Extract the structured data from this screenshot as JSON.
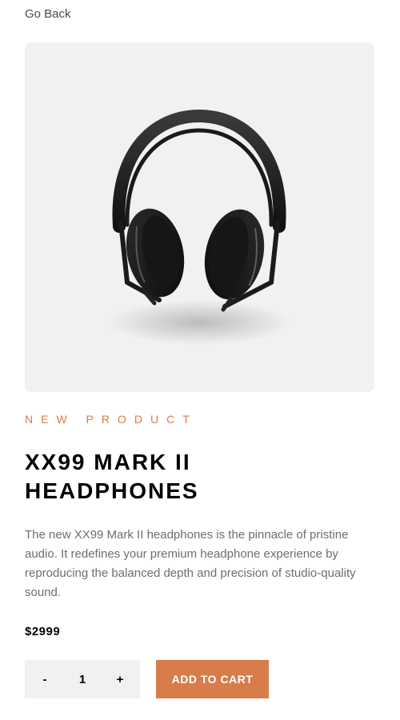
{
  "nav": {
    "back_label": "Go Back"
  },
  "product": {
    "overline": "NEW PRODUCT",
    "title_line1": "XX99 MARK II",
    "title_line2": "HEADPHONES",
    "description": "The new XX99 Mark II headphones is the pinnacle of pristine audio. It redefines your premium headphone experience by reproducing the balanced depth and precision of studio-quality sound.",
    "price": "$2999",
    "image_icon": "headphones-image"
  },
  "cart": {
    "decrement_label": "-",
    "quantity": "1",
    "increment_label": "+",
    "add_label": "ADD TO CART"
  },
  "colors": {
    "accent": "#d87d4a",
    "panel_bg": "#f1f1f1",
    "body_text": "#6e6e6e"
  }
}
